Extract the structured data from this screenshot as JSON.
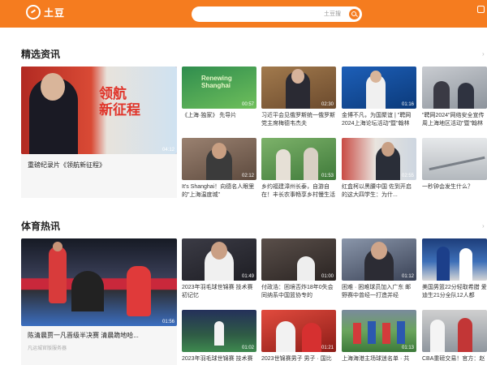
{
  "header": {
    "logo_text": "土豆",
    "search_placeholder": "土豆搜",
    "brand_color": "#f57c1f"
  },
  "sections": [
    {
      "title": "精选资讯",
      "featured": {
        "caption": "重磅纪录片《领航新征程》",
        "duration": "04:12",
        "overlay_text": "领航\n新征程"
      },
      "items": [
        {
          "caption": "《上海·独家》 先导片",
          "duration": "00:57",
          "overlay": "Renewing\nShanghai"
        },
        {
          "caption": "习近平会见俄罗斯统一俄罗斯党主席梅德韦杰夫",
          "duration": "02:30",
          "overlay": ""
        },
        {
          "caption": "金博不凡，为国聚谊 | \"聘网2024上海论坛活动\"暨\"翰林",
          "duration": "01:16",
          "overlay": ""
        },
        {
          "caption": "\"聘网2024\"网络安全宣传周上海地区活动\"暨\"翰林",
          "duration": "",
          "overlay": ""
        },
        {
          "caption": "It's Shanghai！向德名人眼里的\"上海温度城\"",
          "duration": "02:12",
          "overlay": ""
        },
        {
          "caption": "乡约福建漳州长泰，自游自在！丰长农事畅享乡村慢生活",
          "duration": "01:53",
          "overlay": ""
        },
        {
          "caption": "红盒柯以黑腰中国 佐到开启的这大四学生：为什...",
          "duration": "02:55",
          "overlay": ""
        },
        {
          "caption": "一秒钟会发生什么？",
          "duration": "",
          "overlay": ""
        }
      ]
    },
    {
      "title": "体育热讯",
      "featured": {
        "caption": "陈清晨贾一凡晋级半决赛 清晨跪地哈...",
        "subcaption": "凡运城官版服务器",
        "duration": "01:56"
      },
      "items": [
        {
          "caption": "2023年羽毛球世锦赛 技术赛初记忆",
          "duration": "01:49"
        },
        {
          "caption": "付政浩：困境否炸18年0失会同纳系中国篮协专的",
          "duration": "01:00"
        },
        {
          "caption": "困难 · 困难球员加入广东 邮野赛中曾经一打造并经",
          "duration": "01:12"
        },
        {
          "caption": "美国男篮22分轻取希腊 爱迪生21分全队12人都",
          "duration": ""
        },
        {
          "caption": "2023年羽毛球世锦赛 技术赛",
          "duration": "01:02"
        },
        {
          "caption": "2023世锦赛男子 男子 · 国比",
          "duration": "01:21"
        },
        {
          "caption": "上海海港主场球迷名单 · 共",
          "duration": "01:13"
        },
        {
          "caption": "CBA重磅交易！官方：赵睿",
          "duration": ""
        }
      ]
    }
  ]
}
